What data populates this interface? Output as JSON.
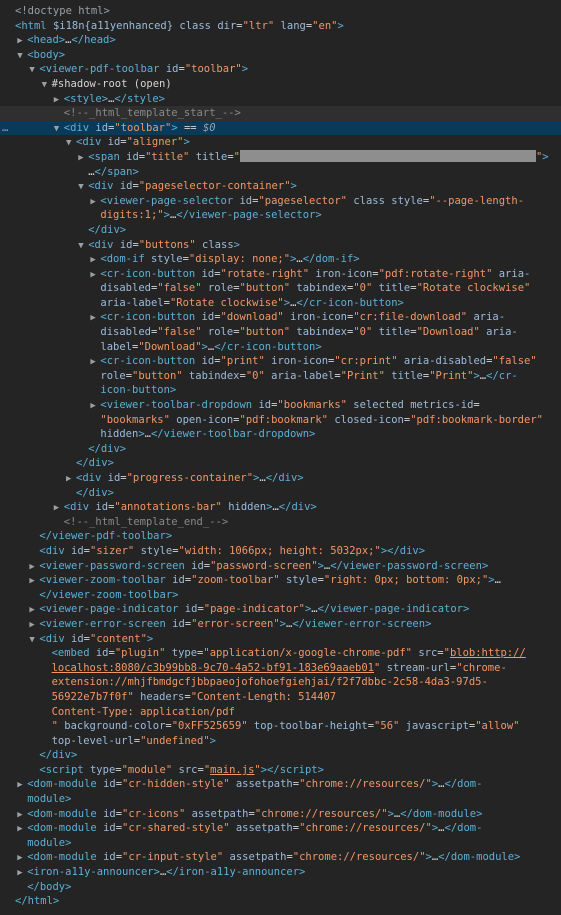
{
  "lines": [
    {
      "i": 0,
      "tri": "",
      "html": "<span class='dim'>&lt;!doctype html&gt;</span>"
    },
    {
      "i": 0,
      "tri": "",
      "html": "<span class='tag'>&lt;html</span> <span class='attr'>$i18n{a11yenhanced}</span> <span class='attr'>class</span> <span class='attr'>dir</span>=<span class='val'>\"ltr\"</span> <span class='attr'>lang</span>=<span class='val'>\"en\"</span><span class='tag'>&gt;</span>"
    },
    {
      "i": 1,
      "tri": "▶",
      "html": "<span class='tag'>&lt;head&gt;</span>…<span class='tag'>&lt;/head&gt;</span>"
    },
    {
      "i": 1,
      "tri": "▼",
      "html": "<span class='tag'>&lt;body&gt;</span>"
    },
    {
      "i": 2,
      "tri": "▼",
      "html": "<span class='tag'>&lt;viewer-pdf-toolbar</span> <span class='attr'>id</span>=<span class='val'>\"toolbar\"</span><span class='tag'>&gt;</span>"
    },
    {
      "i": 3,
      "tri": "▼",
      "html": "<span class='txt'>#shadow-root (open)</span>"
    },
    {
      "i": 4,
      "tri": "▶",
      "html": "<span class='tag'>&lt;style&gt;</span>…<span class='tag'>&lt;/style&gt;</span>"
    },
    {
      "i": 4,
      "tri": "",
      "cls": "hovered",
      "html": "<span class='comment'>&lt;!--_html_template_start_--&gt;</span>"
    },
    {
      "i": 4,
      "tri": "▼",
      "cls": "selected",
      "dots": true,
      "html": "<span class='tag'>&lt;div</span> <span class='attr'>id</span>=<span class='val'>\"toolbar\"</span><span class='tag'>&gt;</span> <span class='sel-eq'>==</span> <span class='sel-var'>$0</span>"
    },
    {
      "i": 5,
      "tri": "▼",
      "html": "<span class='tag'>&lt;div</span> <span class='attr'>id</span>=<span class='val'>\"aligner\"</span><span class='tag'>&gt;</span>"
    },
    {
      "i": 6,
      "tri": "▶",
      "html": "<span class='tag'>&lt;span</span> <span class='attr'>id</span>=<span class='val'>\"title\"</span> <span class='attr'>title</span>=<span class='val'>\"</span><span class='redact' data-name='redacted-title' data-interactable='false'></span><span class='val'>\"</span><span class='tag'>&gt;</span>"
    },
    {
      "i": 6,
      "tri": "",
      "html": "…<span class='tag'>&lt;/span&gt;</span>"
    },
    {
      "i": 6,
      "tri": "▼",
      "html": "<span class='tag'>&lt;div</span> <span class='attr'>id</span>=<span class='val'>\"pageselector-container\"</span><span class='tag'>&gt;</span>"
    },
    {
      "i": 7,
      "tri": "▶",
      "html": "<span class='tag'>&lt;viewer-page-selector</span> <span class='attr'>id</span>=<span class='val'>\"pageselector\"</span> <span class='attr'>class</span> <span class='attr'>style</span>=<span class='val'>\"--page-length-</span>"
    },
    {
      "i": 7,
      "tri": "",
      "html": "<span class='val'>digits:1;\"</span><span class='tag'>&gt;</span>…<span class='tag'>&lt;/viewer-page-selector&gt;</span>"
    },
    {
      "i": 6,
      "tri": "",
      "html": "<span class='tag'>&lt;/div&gt;</span>"
    },
    {
      "i": 6,
      "tri": "▼",
      "html": "<span class='tag'>&lt;div</span> <span class='attr'>id</span>=<span class='val'>\"buttons\"</span> <span class='attr'>class</span><span class='tag'>&gt;</span>"
    },
    {
      "i": 7,
      "tri": "▶",
      "html": "<span class='tag'>&lt;dom-if</span> <span class='attr'>style</span>=<span class='val'>\"display: none;\"</span><span class='tag'>&gt;</span>…<span class='tag'>&lt;/dom-if&gt;</span>"
    },
    {
      "i": 7,
      "tri": "▶",
      "html": "<span class='tag'>&lt;cr-icon-button</span> <span class='attr'>id</span>=<span class='val'>\"rotate-right\"</span> <span class='attr'>iron-icon</span>=<span class='val'>\"pdf:rotate-right\"</span> <span class='attr'>aria-</span>"
    },
    {
      "i": 7,
      "tri": "",
      "html": "<span class='attr'>disabled</span>=<span class='val'>\"false\"</span> <span class='attr'>role</span>=<span class='val'>\"button\"</span> <span class='attr'>tabindex</span>=<span class='val'>\"0\"</span> <span class='attr'>title</span>=<span class='val'>\"Rotate clockwise\"</span>"
    },
    {
      "i": 7,
      "tri": "",
      "html": "<span class='attr'>aria-label</span>=<span class='val'>\"Rotate clockwise\"</span><span class='tag'>&gt;</span>…<span class='tag'>&lt;/cr-icon-button&gt;</span>"
    },
    {
      "i": 7,
      "tri": "▶",
      "html": "<span class='tag'>&lt;cr-icon-button</span> <span class='attr'>id</span>=<span class='val'>\"download\"</span> <span class='attr'>iron-icon</span>=<span class='val'>\"cr:file-download\"</span> <span class='attr'>aria-</span>"
    },
    {
      "i": 7,
      "tri": "",
      "html": "<span class='attr'>disabled</span>=<span class='val'>\"false\"</span> <span class='attr'>role</span>=<span class='val'>\"button\"</span> <span class='attr'>tabindex</span>=<span class='val'>\"0\"</span> <span class='attr'>title</span>=<span class='val'>\"Download\"</span> <span class='attr'>aria-</span>"
    },
    {
      "i": 7,
      "tri": "",
      "html": "<span class='attr'>label</span>=<span class='val'>\"Download\"</span><span class='tag'>&gt;</span>…<span class='tag'>&lt;/cr-icon-button&gt;</span>"
    },
    {
      "i": 7,
      "tri": "▶",
      "html": "<span class='tag'>&lt;cr-icon-button</span> <span class='attr'>id</span>=<span class='val'>\"print\"</span> <span class='attr'>iron-icon</span>=<span class='val'>\"cr:print\"</span> <span class='attr'>aria-disabled</span>=<span class='val'>\"false\"</span>"
    },
    {
      "i": 7,
      "tri": "",
      "html": "<span class='attr'>role</span>=<span class='val'>\"button\"</span> <span class='attr'>tabindex</span>=<span class='val'>\"0\"</span> <span class='attr'>aria-label</span>=<span class='val'>\"Print\"</span> <span class='attr'>title</span>=<span class='val'>\"Print\"</span><span class='tag'>&gt;</span>…<span class='tag'>&lt;/cr-</span>"
    },
    {
      "i": 7,
      "tri": "",
      "html": "<span class='tag'>icon-button&gt;</span>"
    },
    {
      "i": 7,
      "tri": "▶",
      "html": "<span class='tag'>&lt;viewer-toolbar-dropdown</span> <span class='attr'>id</span>=<span class='val'>\"bookmarks\"</span> <span class='attr'>selected</span> <span class='attr'>metrics-id</span>="
    },
    {
      "i": 7,
      "tri": "",
      "html": "<span class='val'>\"bookmarks\"</span> <span class='attr'>open-icon</span>=<span class='val'>\"pdf:bookmark\"</span> <span class='attr'>closed-icon</span>=<span class='val'>\"pdf:bookmark-border\"</span>"
    },
    {
      "i": 7,
      "tri": "",
      "html": "<span class='attr'>hidden</span><span class='tag'>&gt;</span>…<span class='tag'>&lt;/viewer-toolbar-dropdown&gt;</span>"
    },
    {
      "i": 6,
      "tri": "",
      "html": "<span class='tag'>&lt;/div&gt;</span>"
    },
    {
      "i": 5,
      "tri": "",
      "html": "<span class='tag'>&lt;/div&gt;</span>"
    },
    {
      "i": 5,
      "tri": "▶",
      "html": "<span class='tag'>&lt;div</span> <span class='attr'>id</span>=<span class='val'>\"progress-container\"</span><span class='tag'>&gt;</span>…<span class='tag'>&lt;/div&gt;</span>"
    },
    {
      "i": 5,
      "tri": "",
      "html": "<span class='tag'>&lt;/div&gt;</span>"
    },
    {
      "i": 4,
      "tri": "▶",
      "html": "<span class='tag'>&lt;div</span> <span class='attr'>id</span>=<span class='val'>\"annotations-bar\"</span> <span class='attr'>hidden</span><span class='tag'>&gt;</span>…<span class='tag'>&lt;/div&gt;</span>"
    },
    {
      "i": 4,
      "tri": "",
      "html": "<span class='comment'>&lt;!--_html_template_end_--&gt;</span>"
    },
    {
      "i": 2,
      "tri": "",
      "html": "<span class='tag'>&lt;/viewer-pdf-toolbar&gt;</span>"
    },
    {
      "i": 2,
      "tri": "",
      "html": "<span class='tag'>&lt;div</span> <span class='attr'>id</span>=<span class='val'>\"sizer\"</span> <span class='attr'>style</span>=<span class='val'>\"width: 1066px; height: 5032px;\"</span><span class='tag'>&gt;&lt;/div&gt;</span>"
    },
    {
      "i": 2,
      "tri": "▶",
      "html": "<span class='tag'>&lt;viewer-password-screen</span> <span class='attr'>id</span>=<span class='val'>\"password-screen\"</span><span class='tag'>&gt;</span>…<span class='tag'>&lt;/viewer-password-screen&gt;</span>"
    },
    {
      "i": 2,
      "tri": "▶",
      "html": "<span class='tag'>&lt;viewer-zoom-toolbar</span> <span class='attr'>id</span>=<span class='val'>\"zoom-toolbar\"</span> <span class='attr'>style</span>=<span class='val'>\"right: 0px; bottom: 0px;\"</span><span class='tag'>&gt;</span>…"
    },
    {
      "i": 2,
      "tri": "",
      "html": "<span class='tag'>&lt;/viewer-zoom-toolbar&gt;</span>"
    },
    {
      "i": 2,
      "tri": "▶",
      "html": "<span class='tag'>&lt;viewer-page-indicator</span> <span class='attr'>id</span>=<span class='val'>\"page-indicator\"</span><span class='tag'>&gt;</span>…<span class='tag'>&lt;/viewer-page-indicator&gt;</span>"
    },
    {
      "i": 2,
      "tri": "▶",
      "html": "<span class='tag'>&lt;viewer-error-screen</span> <span class='attr'>id</span>=<span class='val'>\"error-screen\"</span><span class='tag'>&gt;</span>…<span class='tag'>&lt;/viewer-error-screen&gt;</span>"
    },
    {
      "i": 2,
      "tri": "▼",
      "html": "<span class='tag'>&lt;div</span> <span class='attr'>id</span>=<span class='val'>\"content\"</span><span class='tag'>&gt;</span>"
    },
    {
      "i": 3,
      "tri": "",
      "html": "<span class='tag'>&lt;embed</span> <span class='attr'>id</span>=<span class='val'>\"plugin\"</span> <span class='attr'>type</span>=<span class='val'>\"application/x-google-chrome-pdf\"</span> <span class='attr'>src</span>=<span class='val'>\"</span><span class='link'>blob:http://</span>"
    },
    {
      "i": 3,
      "tri": "",
      "html": "<span class='link'>localhost:8080/c3b99bb8-9c70-4a52-bf91-183e69aaeb01</span><span class='val'>\"</span> <span class='attr'>stream-url</span>=<span class='val'>\"chrome-</span>"
    },
    {
      "i": 3,
      "tri": "",
      "html": "<span class='val'>extension://mhjfbmdgcfjbbpaeojofohoefgiehjai/f2f7dbbc-2c58-4da3-97d5-</span>"
    },
    {
      "i": 3,
      "tri": "",
      "html": "<span class='val'>56922e7b7f0f\"</span> <span class='attr'>headers</span>=<span class='val'>\"Content-Length: 514407</span>"
    },
    {
      "i": 3,
      "tri": "",
      "html": "<span class='val'>Content-Type: application/pdf</span>"
    },
    {
      "i": 3,
      "tri": "",
      "html": "<span class='val'>\"</span> <span class='attr'>background-color</span>=<span class='val'>\"0xFF525659\"</span> <span class='attr'>top-toolbar-height</span>=<span class='val'>\"56\"</span> <span class='attr'>javascript</span>=<span class='val'>\"allow\"</span>"
    },
    {
      "i": 3,
      "tri": "",
      "html": "<span class='attr'>top-level-url</span>=<span class='val'>\"undefined\"</span><span class='tag'>&gt;</span>"
    },
    {
      "i": 2,
      "tri": "",
      "html": "<span class='tag'>&lt;/div&gt;</span>"
    },
    {
      "i": 2,
      "tri": "",
      "html": "<span class='tag'>&lt;script</span> <span class='attr'>type</span>=<span class='val'>\"module\"</span> <span class='attr'>src</span>=<span class='val'>\"</span><span class='link'>main.js</span><span class='val'>\"</span><span class='tag'>&gt;&lt;/script&gt;</span>"
    },
    {
      "i": 1,
      "tri": "▶",
      "html": "<span class='tag'>&lt;dom-module</span> <span class='attr'>id</span>=<span class='val'>\"cr-hidden-style\"</span> <span class='attr'>assetpath</span>=<span class='val'>\"chrome://resources/\"</span><span class='tag'>&gt;</span>…<span class='tag'>&lt;/dom-</span>"
    },
    {
      "i": 1,
      "tri": "",
      "html": "<span class='tag'>module&gt;</span>"
    },
    {
      "i": 1,
      "tri": "▶",
      "html": "<span class='tag'>&lt;dom-module</span> <span class='attr'>id</span>=<span class='val'>\"cr-icons\"</span> <span class='attr'>assetpath</span>=<span class='val'>\"chrome://resources/\"</span><span class='tag'>&gt;</span>…<span class='tag'>&lt;/dom-module&gt;</span>"
    },
    {
      "i": 1,
      "tri": "▶",
      "html": "<span class='tag'>&lt;dom-module</span> <span class='attr'>id</span>=<span class='val'>\"cr-shared-style\"</span> <span class='attr'>assetpath</span>=<span class='val'>\"chrome://resources/\"</span><span class='tag'>&gt;</span>…<span class='tag'>&lt;/dom-</span>"
    },
    {
      "i": 1,
      "tri": "",
      "html": "<span class='tag'>module&gt;</span>"
    },
    {
      "i": 1,
      "tri": "▶",
      "html": "<span class='tag'>&lt;dom-module</span> <span class='attr'>id</span>=<span class='val'>\"cr-input-style\"</span> <span class='attr'>assetpath</span>=<span class='val'>\"chrome://resources/\"</span><span class='tag'>&gt;</span>…<span class='tag'>&lt;/dom-module&gt;</span>"
    },
    {
      "i": 1,
      "tri": "▶",
      "html": "<span class='tag'>&lt;iron-a11y-announcer&gt;</span>…<span class='tag'>&lt;/iron-a11y-announcer&gt;</span>"
    },
    {
      "i": 1,
      "tri": "",
      "html": "<span class='tag'>&lt;/body&gt;</span>"
    },
    {
      "i": 0,
      "tri": "",
      "html": "<span class='tag'>&lt;/html&gt;</span>"
    }
  ]
}
